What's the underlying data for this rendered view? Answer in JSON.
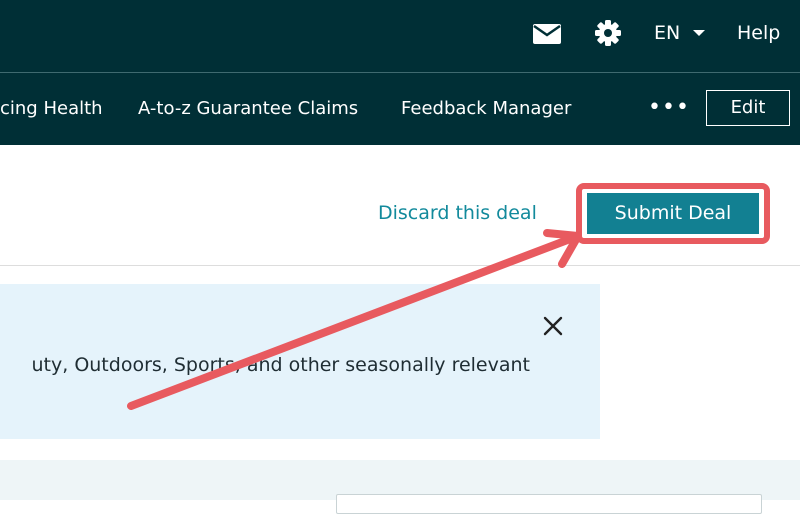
{
  "header": {
    "language_label": "EN",
    "help_label": "Help"
  },
  "nav": {
    "items": [
      {
        "label": "cing Health"
      },
      {
        "label": "A-to-z Guarantee Claims"
      },
      {
        "label": "Feedback Manager"
      }
    ],
    "more_label": "•••",
    "edit_label": "Edit"
  },
  "actions": {
    "discard_label": "Discard this deal",
    "submit_label": "Submit Deal"
  },
  "banner": {
    "text": "uty, Outdoors, Sports, and other seasonally relevant"
  },
  "annotation": {
    "color": "#e85a5f"
  }
}
